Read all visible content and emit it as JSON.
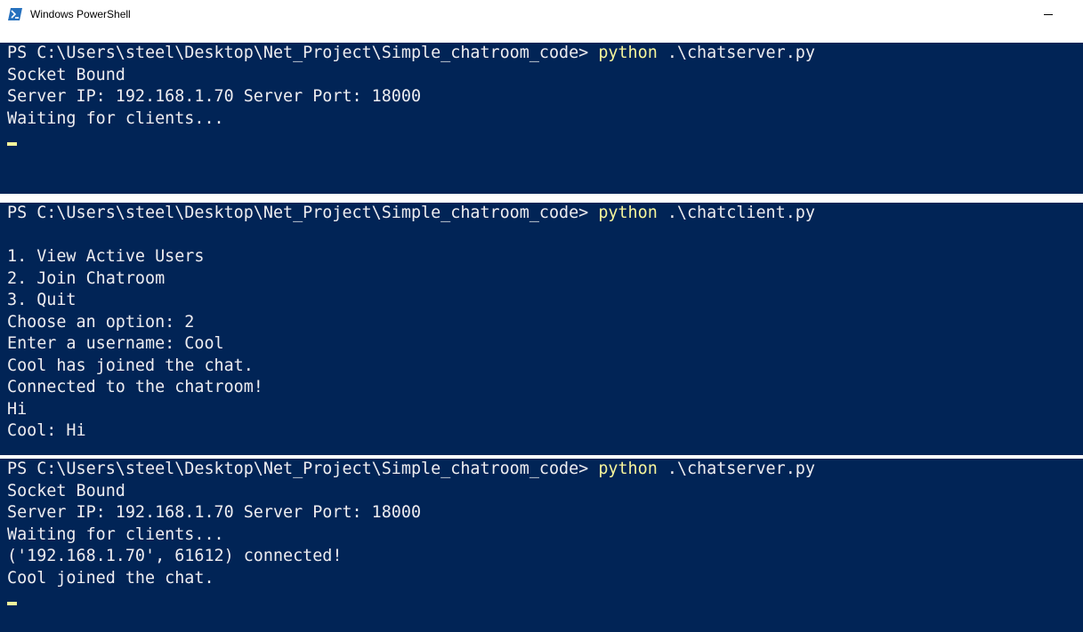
{
  "window": {
    "title": "Windows PowerShell",
    "icon": "powershell-icon",
    "minimize_label": "—"
  },
  "colors": {
    "console_bg": "#012456",
    "text": "#eeedf0",
    "command_highlight": "#f6f59b"
  },
  "server_panel_1": {
    "prompt": "PS C:\\Users\\steel\\Desktop\\Net_Project\\Simple_chatroom_code> ",
    "command": "python",
    "argument": " .\\chatserver.py",
    "lines": [
      "Socket Bound",
      "Server IP: 192.168.1.70 Server Port: 18000",
      "Waiting for clients..."
    ]
  },
  "client_panel": {
    "prompt": "PS C:\\Users\\steel\\Desktop\\Net_Project\\Simple_chatroom_code> ",
    "command": "python",
    "argument": " .\\chatclient.py",
    "lines": [
      "",
      "1. View Active Users",
      "2. Join Chatroom",
      "3. Quit",
      "Choose an option: 2",
      "Enter a username: Cool",
      "Cool has joined the chat.",
      "Connected to the chatroom!",
      "Hi",
      "Cool: Hi"
    ]
  },
  "server_panel_2": {
    "prompt": "PS C:\\Users\\steel\\Desktop\\Net_Project\\Simple_chatroom_code> ",
    "command": "python",
    "argument": " .\\chatserver.py",
    "lines": [
      "Socket Bound",
      "Server IP: 192.168.1.70 Server Port: 18000",
      "Waiting for clients...",
      "('192.168.1.70', 61612) connected!",
      "Cool joined the chat."
    ]
  }
}
